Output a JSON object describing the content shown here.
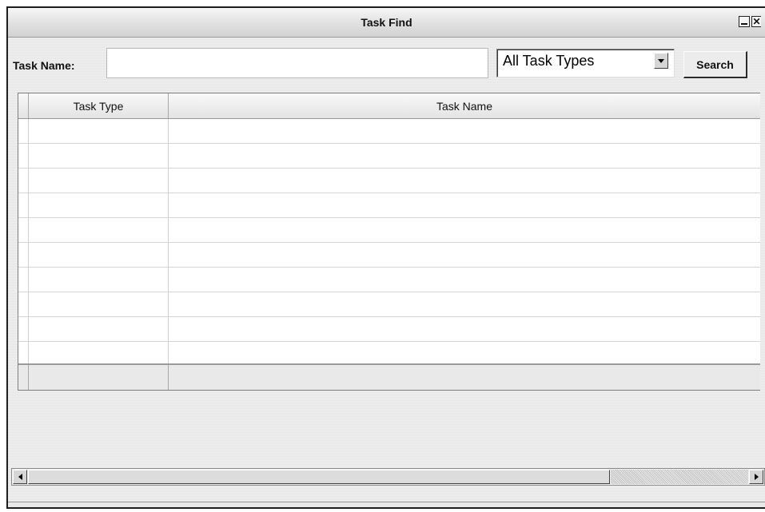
{
  "window": {
    "title": "Task Find"
  },
  "search": {
    "label": "Task Name:",
    "value": "",
    "placeholder": "",
    "type_select": "All Task Types",
    "button": "Search"
  },
  "table": {
    "columns": [
      "",
      "Task Type",
      "Task Name"
    ],
    "rows": [
      [
        "",
        "",
        ""
      ],
      [
        "",
        "",
        ""
      ],
      [
        "",
        "",
        ""
      ],
      [
        "",
        "",
        ""
      ],
      [
        "",
        "",
        ""
      ],
      [
        "",
        "",
        ""
      ],
      [
        "",
        "",
        ""
      ],
      [
        "",
        "",
        ""
      ],
      [
        "",
        "",
        ""
      ],
      [
        "",
        "",
        ""
      ]
    ]
  },
  "icons": {
    "minimize": "minimize-icon",
    "close": "close-icon",
    "dropdown": "chevron-down-icon",
    "scroll_left": "arrow-left-icon",
    "scroll_right": "arrow-right-icon"
  }
}
